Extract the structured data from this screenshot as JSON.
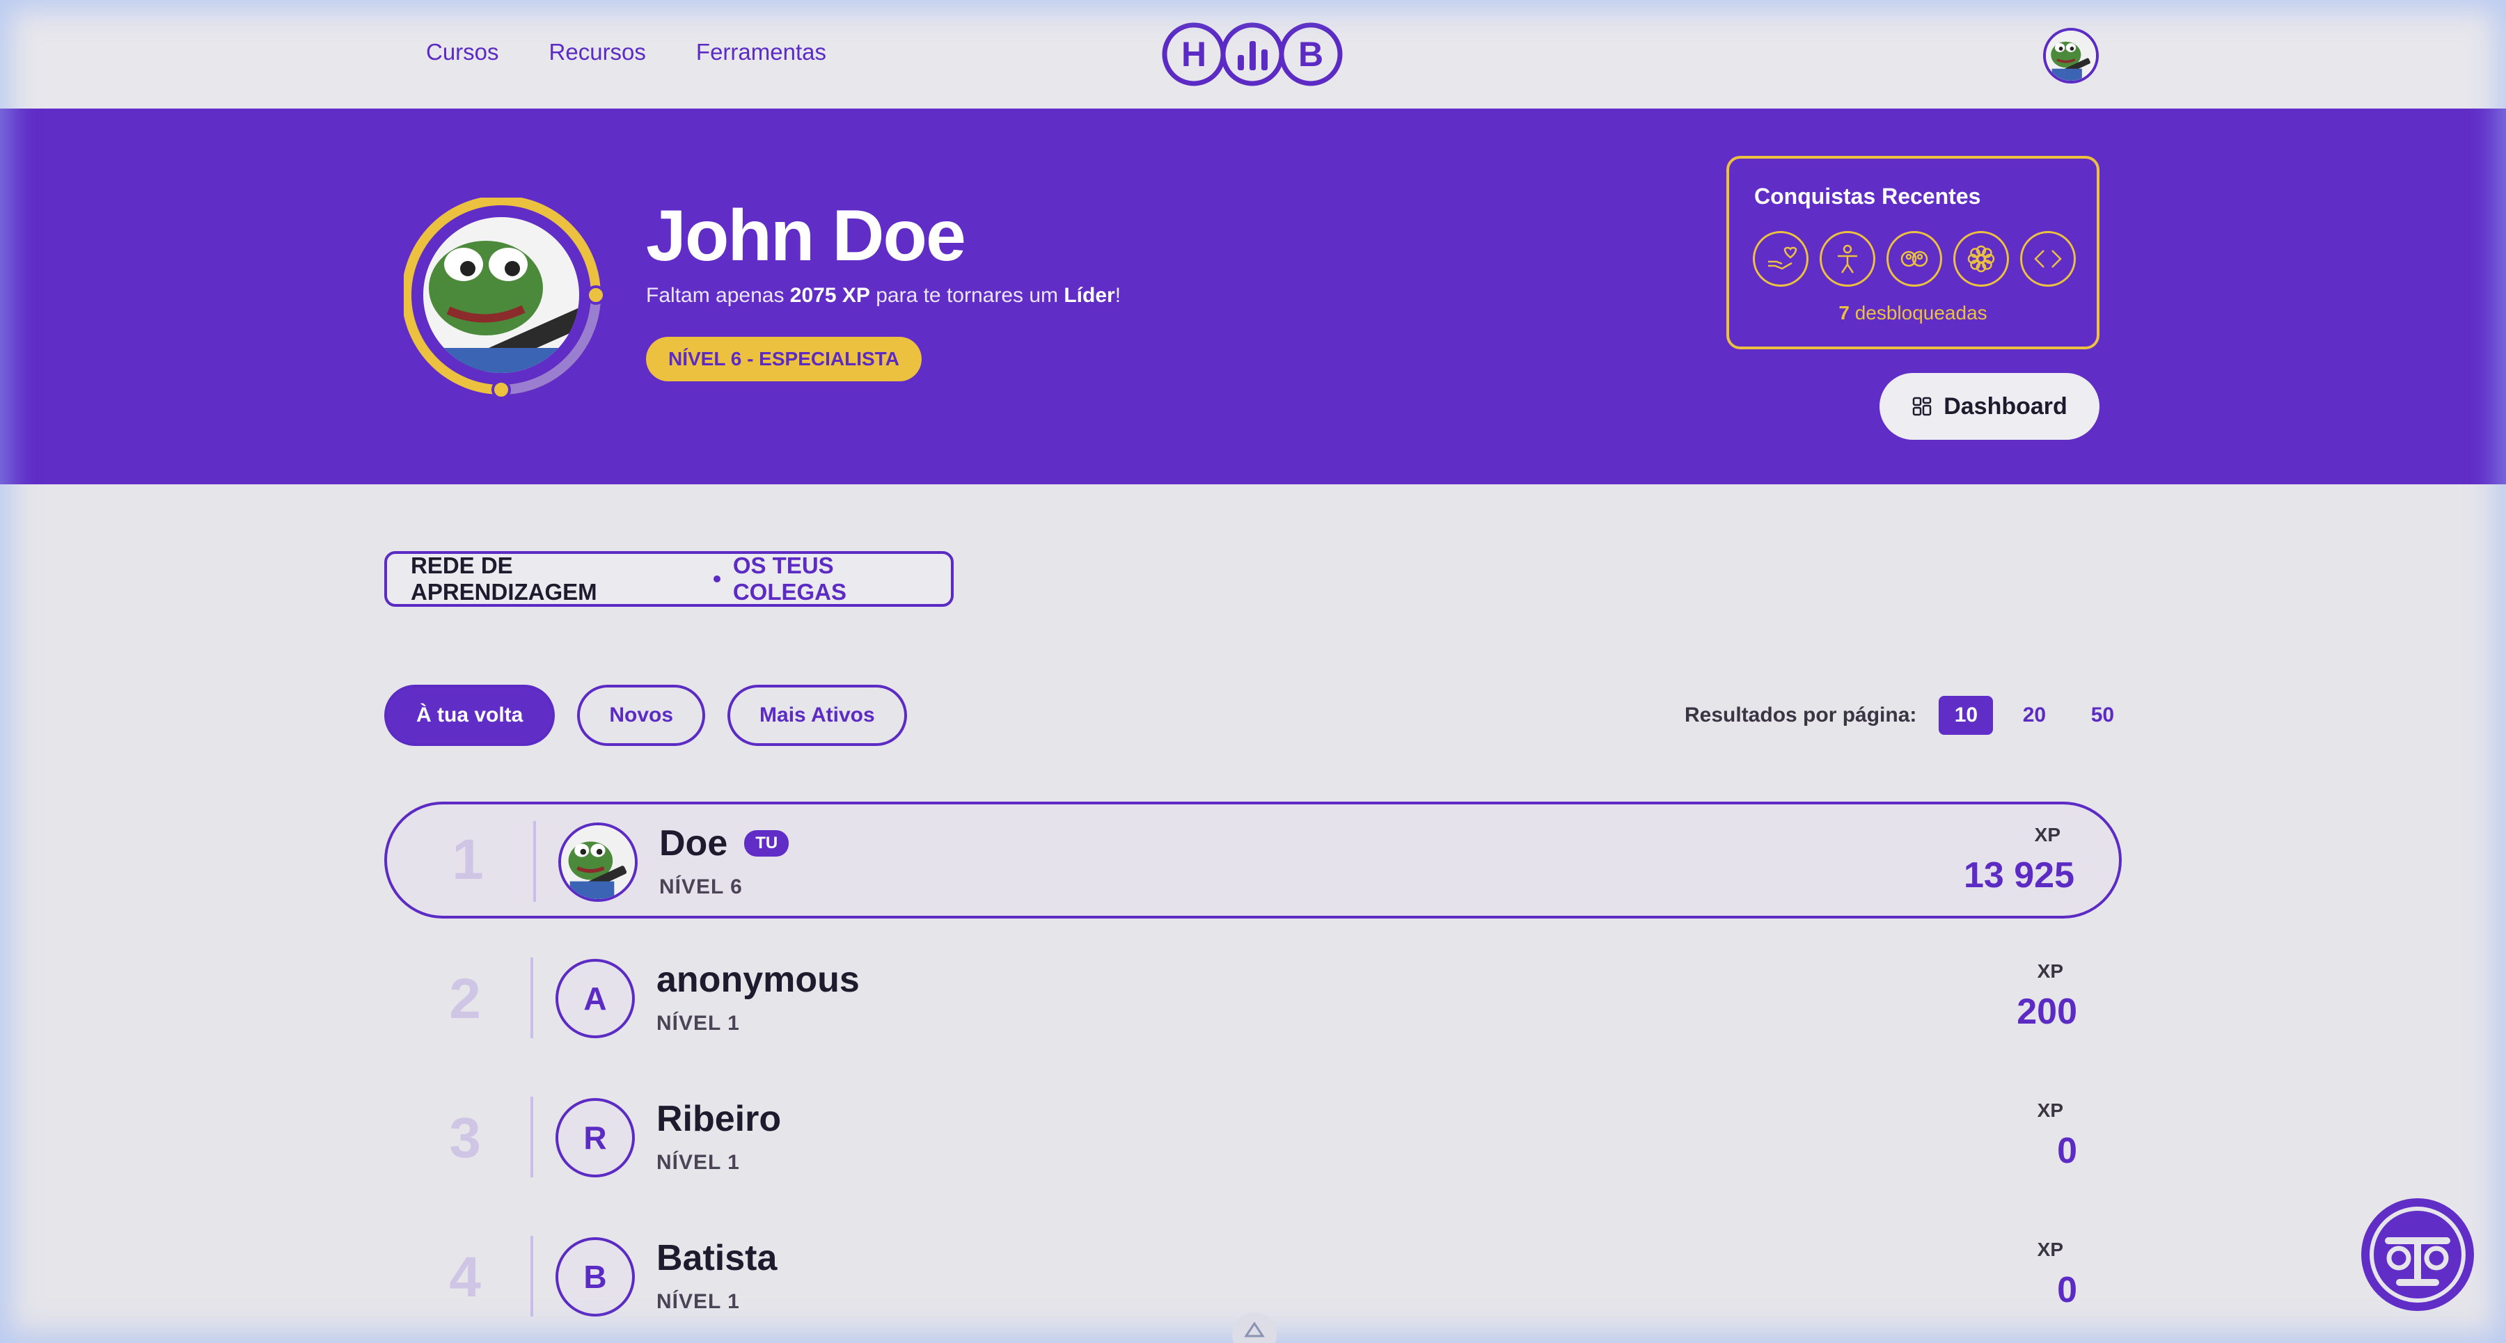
{
  "nav": {
    "links": [
      "Cursos",
      "Recursos",
      "Ferramentas"
    ],
    "logo_letters": [
      "H",
      "B"
    ],
    "avatar_icon": "user-avatar-frog"
  },
  "hero": {
    "name": "John Doe",
    "sub_prefix": "Faltam apenas ",
    "sub_xp": "2075 XP",
    "sub_middle": " para te tornares um ",
    "sub_rank": "Líder",
    "sub_suffix": "!",
    "level_badge": "NÍVEL 6 - ESPECIALISTA",
    "level_progress_fraction": 0.6
  },
  "achievements": {
    "title": "Conquistas Recentes",
    "icons": [
      "hand-heart-icon",
      "person-icon",
      "group-icon",
      "flower-icon",
      "code-icon"
    ],
    "count": "7",
    "count_label": " desbloqueadas"
  },
  "dashboard_label": "Dashboard",
  "section": {
    "title": "REDE DE APRENDIZAGEM",
    "subtitle": "OS TEUS COLEGAS"
  },
  "filters": [
    "À tua volta",
    "Novos",
    "Mais Ativos"
  ],
  "per_page": {
    "label": "Resultados por página:",
    "options": [
      "10",
      "20",
      "50"
    ],
    "selected": "10"
  },
  "ranking": [
    {
      "pos": "1",
      "name": "Doe",
      "badge": "TU",
      "level": "NÍVEL 6",
      "xp_label": "XP",
      "xp": "13 925",
      "avatar": "frog"
    },
    {
      "pos": "2",
      "name": "anonymous",
      "level": "NÍVEL 1",
      "xp_label": "XP",
      "xp": "200",
      "initial": "A"
    },
    {
      "pos": "3",
      "name": "Ribeiro",
      "level": "NÍVEL 1",
      "xp_label": "XP",
      "xp": "0",
      "initial": "R"
    },
    {
      "pos": "4",
      "name": "Batista",
      "level": "NÍVEL 1",
      "xp_label": "XP",
      "xp": "0",
      "initial": "B"
    }
  ],
  "colors": {
    "primary": "#602dc7",
    "accent": "#ecc13f",
    "background": "#e6e5ea"
  }
}
